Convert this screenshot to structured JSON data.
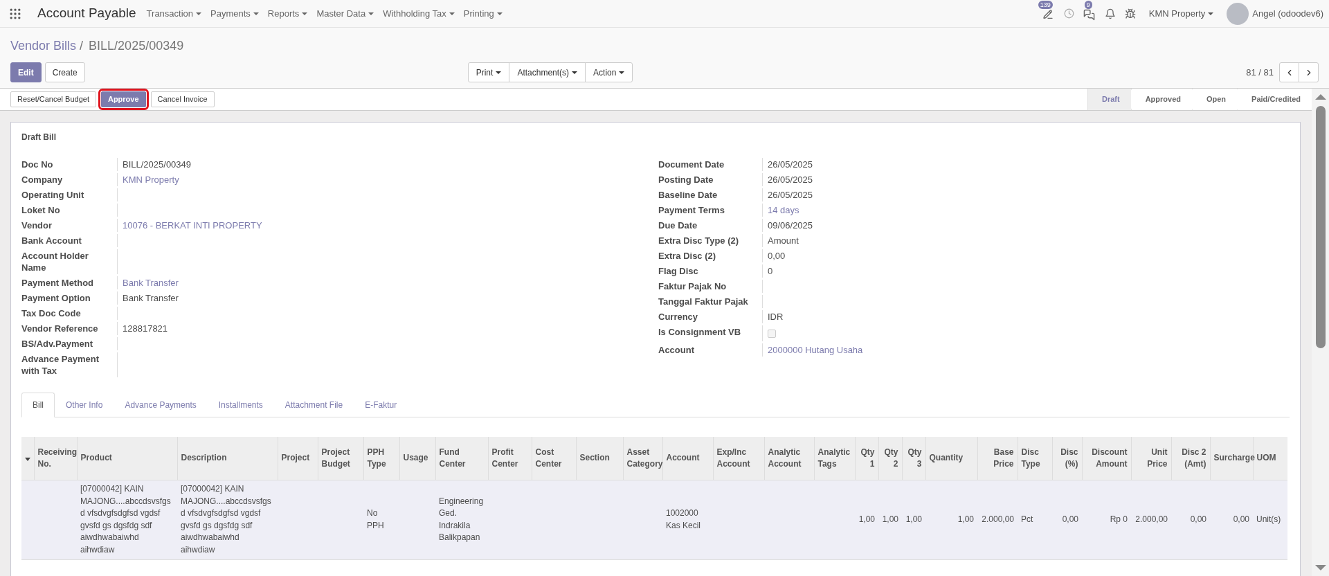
{
  "navbar": {
    "app_title": "Account Payable",
    "menus": [
      {
        "label": "Transaction"
      },
      {
        "label": "Payments"
      },
      {
        "label": "Reports"
      },
      {
        "label": "Master Data"
      },
      {
        "label": "Withholding Tax"
      },
      {
        "label": "Printing"
      }
    ],
    "activity_badge": "139",
    "messages_badge": "9",
    "company": "KMN Property",
    "user": "Angel (odoodev6)"
  },
  "breadcrumb": {
    "parent": "Vendor Bills",
    "separator": "/",
    "current": "BILL/2025/00349"
  },
  "buttons": [
    {
      "label": "Edit",
      "primary": true
    },
    {
      "label": "Create",
      "primary": false
    }
  ],
  "dropdowns": [
    {
      "label": "Print"
    },
    {
      "label": "Attachment(s)"
    },
    {
      "label": "Action"
    }
  ],
  "pager": {
    "text": "81 / 81"
  },
  "header_buttons": [
    {
      "label": "Reset/Cancel Budget",
      "primary": false,
      "highlighted": false
    },
    {
      "label": "Approve",
      "primary": true,
      "highlighted": true
    },
    {
      "label": "Cancel Invoice",
      "primary": false,
      "highlighted": false
    }
  ],
  "statuses": [
    {
      "label": "Draft",
      "selected": true
    },
    {
      "label": "Approved",
      "selected": false
    },
    {
      "label": "Open",
      "selected": false
    },
    {
      "label": "Paid/Credited",
      "selected": false
    }
  ],
  "sheet": {
    "title": "Draft Bill",
    "left_fields": [
      {
        "label": "Doc No",
        "kind": "text",
        "value": "BILL/2025/00349"
      },
      {
        "label": "Company",
        "kind": "link",
        "value": "KMN Property"
      },
      {
        "label": "Operating Unit",
        "kind": "empty"
      },
      {
        "label": "Loket No",
        "kind": "empty"
      },
      {
        "label": "Vendor",
        "kind": "link",
        "value": "10076 - BERKAT INTI PROPERTY"
      },
      {
        "label": "Bank Account",
        "kind": "empty"
      },
      {
        "label": "Account Holder Name",
        "kind": "empty"
      },
      {
        "label": "Payment Method",
        "kind": "link",
        "value": "Bank Transfer"
      },
      {
        "label": "Payment Option",
        "kind": "text",
        "value": "Bank Transfer"
      },
      {
        "label": "Tax Doc Code",
        "kind": "empty"
      },
      {
        "label": "Vendor Reference",
        "kind": "text",
        "value": "128817821"
      },
      {
        "label": "BS/Adv.Payment",
        "kind": "empty"
      },
      {
        "label": "Advance Payment with Tax",
        "kind": "empty"
      }
    ],
    "right_fields": [
      {
        "label": "Document Date",
        "kind": "text",
        "value": "26/05/2025"
      },
      {
        "label": "Posting Date",
        "kind": "text",
        "value": "26/05/2025"
      },
      {
        "label": "Baseline Date",
        "kind": "text",
        "value": "26/05/2025"
      },
      {
        "label": "Payment Terms",
        "kind": "link",
        "value": "14 days"
      },
      {
        "label": "Due Date",
        "kind": "text",
        "value": "09/06/2025"
      },
      {
        "label": "Extra Disc Type (2)",
        "kind": "text",
        "value": "Amount"
      },
      {
        "label": "Extra Disc (2)",
        "kind": "text",
        "value": "0,00"
      },
      {
        "label": "Flag Disc",
        "kind": "text",
        "value": "0"
      },
      {
        "label": "Faktur Pajak No",
        "kind": "empty"
      },
      {
        "label": "Tanggal Faktur Pajak",
        "kind": "empty"
      },
      {
        "label": "Currency",
        "kind": "text",
        "value": "IDR"
      },
      {
        "label": "Is Consignment VB",
        "kind": "checkbox",
        "checked": false
      },
      {
        "label": "Account",
        "kind": "link",
        "value": "2000000 Hutang Usaha"
      }
    ],
    "tabs": [
      {
        "label": "Bill",
        "selected": true
      },
      {
        "label": "Other Info",
        "selected": false
      },
      {
        "label": "Advance Payments",
        "selected": false
      },
      {
        "label": "Installments",
        "selected": false
      },
      {
        "label": "Attachment File",
        "selected": false
      },
      {
        "label": "E-Faktur",
        "selected": false
      }
    ],
    "table": {
      "columns": [
        {
          "label": "Receiving No."
        },
        {
          "label": "Product"
        },
        {
          "label": "Description"
        },
        {
          "label": "Project"
        },
        {
          "label": "Project Budget"
        },
        {
          "label": "PPH Type"
        },
        {
          "label": "Usage"
        },
        {
          "label": "Fund Center"
        },
        {
          "label": "Profit Center"
        },
        {
          "label": "Cost Center"
        },
        {
          "label": "Section"
        },
        {
          "label": "Asset Category"
        },
        {
          "label": "Account"
        },
        {
          "label": "Exp/Inc Account"
        },
        {
          "label": "Analytic Account"
        },
        {
          "label": "Analytic Tags"
        },
        {
          "label": "Qty 1"
        },
        {
          "label": "Qty 2"
        },
        {
          "label": "Qty 3"
        },
        {
          "label": "Quantity"
        },
        {
          "label": "Base Price"
        },
        {
          "label": "Disc Type"
        },
        {
          "label": "Disc (%)"
        },
        {
          "label": "Discount Amount"
        },
        {
          "label": "Unit Price"
        },
        {
          "label": "Disc 2 (Amt)"
        },
        {
          "label": "Surcharge"
        },
        {
          "label": "UOM"
        }
      ],
      "rows": [
        {
          "cells": [
            "",
            "[07000042] KAIN MAJONG....abccdsvsfgsd vfsdvgfsdgfsd vgdsf gvsfd gs dgsfdg sdf aiwdhwabaiwhd aihwdiaw",
            "[07000042] KAIN MAJONG....abccdsvsfgsd vfsdvgfsdgfsd vgdsf gvsfd gs dgsfdg sdf aiwdhwabaiwhd aihwdiaw",
            "",
            "",
            "No PPH",
            "",
            "Engineering Ged. Indrakila Balikpapan",
            "",
            "",
            "",
            "",
            "1002000 Kas Kecil",
            "",
            "",
            "",
            "1,00",
            "1,00",
            "1,00",
            "1,00",
            "2.000,00",
            "Pct",
            "0,00",
            "Rp 0",
            "2.000,00",
            "0,00",
            "0,00",
            "Unit(s)"
          ]
        }
      ]
    }
  }
}
